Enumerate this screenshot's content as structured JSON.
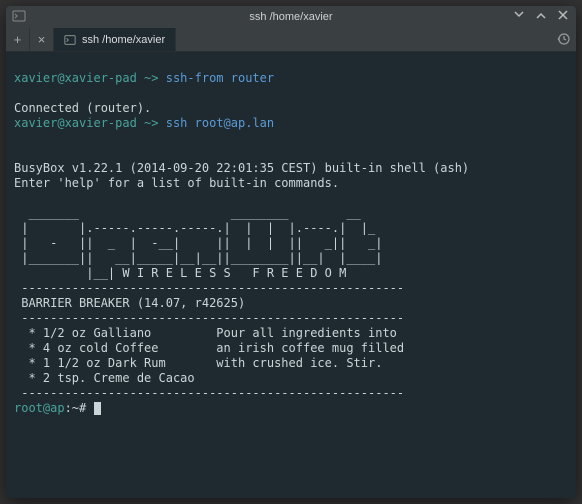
{
  "window": {
    "title": "ssh  /home/xavier"
  },
  "tabs": {
    "active_label": "ssh  /home/xavier"
  },
  "terminal": {
    "line1_user": "xavier@xavier-pad",
    "line1_tilde": " ~> ",
    "line1_cmd1": "ssh-from",
    "line1_cmd2": " router",
    "blank1": "",
    "connected": "Connected (router).",
    "line2_user": "xavier@xavier-pad",
    "line2_tilde": " ~> ",
    "line2_cmd1": "ssh",
    "line2_cmd2": " root@ap.lan",
    "blank2": "",
    "blank3": "",
    "busybox": "BusyBox v1.22.1 (2014-09-20 22:01:35 CEST) built-in shell (ash)",
    "help": "Enter 'help' for a list of built-in commands.",
    "blank4": "",
    "art1": "  _______                     ________        __",
    "art2": " |       |.-----.-----.-----.|  |  |  |.----.|  |_",
    "art3": " |   -   ||  _  |  -__|     ||  |  |  ||   _||   _|",
    "art4": " |_______||   __|_____|__|__||________||__|  |____|",
    "art5": "          |__| W I R E L E S S   F R E E D O M",
    "sep1": " -----------------------------------------------------",
    "release": " BARRIER BREAKER (14.07, r42625)",
    "sep2": " -----------------------------------------------------",
    "ing1": "  * 1/2 oz Galliano         Pour all ingredients into",
    "ing2": "  * 4 oz cold Coffee        an irish coffee mug filled",
    "ing3": "  * 1 1/2 oz Dark Rum       with crushed ice. Stir.",
    "ing4": "  * 2 tsp. Creme de Cacao",
    "sep3": " -----------------------------------------------------",
    "prompt_user": "root@ap",
    "prompt_rest": ":~# "
  }
}
